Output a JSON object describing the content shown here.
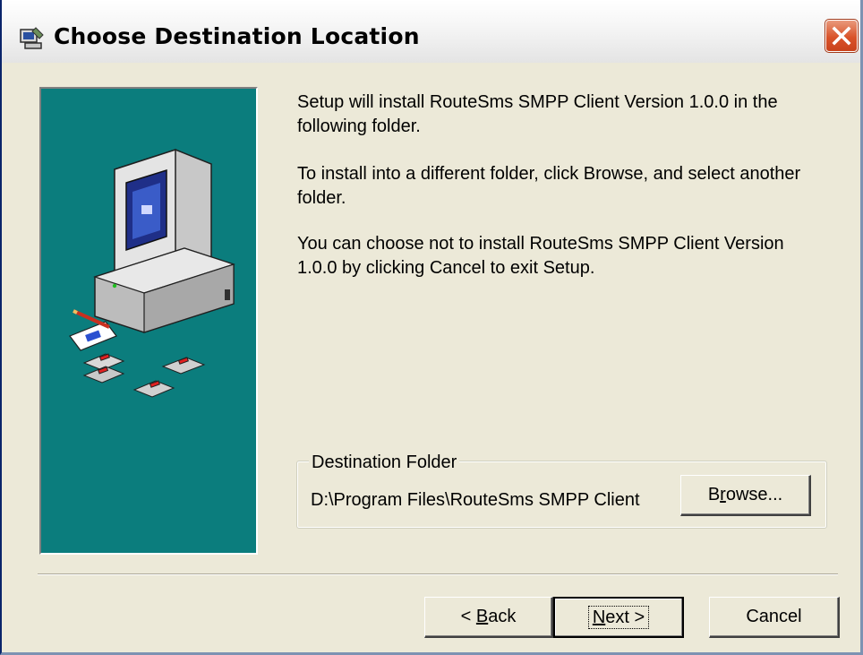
{
  "window": {
    "title": "Choose Destination Location",
    "icon": "setup-computer-icon",
    "close_icon": "close-icon"
  },
  "side_panel": {
    "background_color": "#0b7d7d",
    "illustration": "computer-with-floppy-disks-illustration"
  },
  "content": {
    "paragraph1": "Setup will install RouteSms SMPP Client Version 1.0.0 in the following folder.",
    "paragraph2": "To install into a different folder, click Browse, and select another folder.",
    "paragraph3": "You can choose not to install RouteSms SMPP Client Version 1.0.0 by clicking Cancel to exit Setup."
  },
  "destination": {
    "group_label": "Destination Folder",
    "path": "D:\\Program Files\\RouteSms SMPP Client",
    "browse_label_pre": "B",
    "browse_label_mnemonic": "r",
    "browse_label_post": "owse..."
  },
  "footer": {
    "back_arrow": "< ",
    "back_mnemonic": "B",
    "back_rest": "ack",
    "next_mnemonic": "N",
    "next_rest": "ext >",
    "cancel_label": "Cancel"
  }
}
